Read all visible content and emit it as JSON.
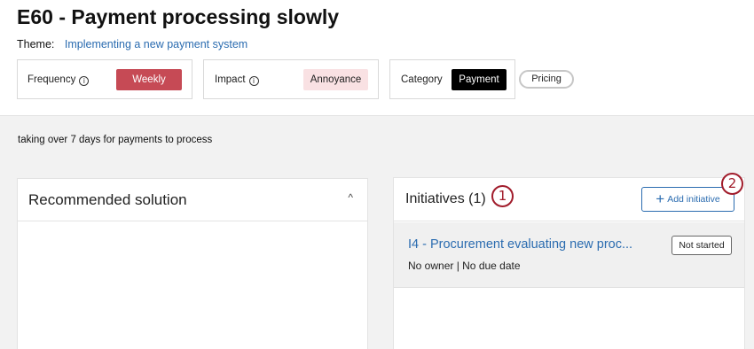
{
  "issue": {
    "title": "E60 - Payment processing slowly",
    "theme_label": "Theme:",
    "theme_value": "Implementing a new payment system"
  },
  "attributes": {
    "frequency": {
      "label": "Frequency",
      "value": "Weekly",
      "color": "#c64a55"
    },
    "impact": {
      "label": "Impact",
      "value": "Annoyance",
      "color": "#f9e1e3"
    },
    "category": {
      "label": "Category",
      "value": "Payment",
      "color": "#000000"
    },
    "tag": "Pricing"
  },
  "description": "taking over 7 days for payments to process",
  "recommended": {
    "title": "Recommended solution",
    "chevron": "^"
  },
  "initiatives": {
    "title": "Initiatives (1)",
    "add_label": "Add initiative",
    "items": [
      {
        "name": "I4 - Procurement evaluating new proc...",
        "meta": "No owner | No due date",
        "status": "Not started"
      }
    ]
  },
  "markers": [
    "1",
    "2"
  ],
  "icons": {
    "info": "info-icon",
    "plus": "plus-icon",
    "collapse": "chevron-up-icon"
  },
  "colors": {
    "link": "#2b6cb0",
    "marker": "#a11c2b"
  }
}
